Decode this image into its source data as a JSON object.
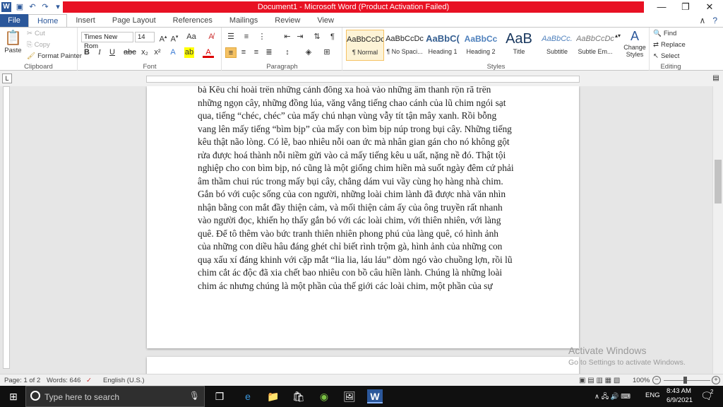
{
  "title_bar": {
    "title": "Document1 - Microsoft Word (Product Activation Failed)",
    "minimize": "—",
    "restore": "❐",
    "close": "✕"
  },
  "tabs": [
    "File",
    "Home",
    "Insert",
    "Page Layout",
    "References",
    "Mailings",
    "Review",
    "View"
  ],
  "ribbon": {
    "clipboard": {
      "label": "Clipboard",
      "paste": "Paste",
      "cut": "Cut",
      "copy": "Copy",
      "format_painter": "Format Painter"
    },
    "font": {
      "label": "Font",
      "font_name": "Times New Rom",
      "font_size": "14"
    },
    "paragraph": {
      "label": "Paragraph"
    },
    "styles": {
      "label": "Styles",
      "items": [
        {
          "preview": "AaBbCcDc",
          "name": "¶ Normal"
        },
        {
          "preview": "AaBbCcDc",
          "name": "¶ No Spaci..."
        },
        {
          "preview": "AaBbC(",
          "name": "Heading 1"
        },
        {
          "preview": "AaBbCc",
          "name": "Heading 2"
        },
        {
          "preview": "AaB",
          "name": "Title"
        },
        {
          "preview": "AaBbCc.",
          "name": "Subtitle"
        },
        {
          "preview": "AaBbCcDc",
          "name": "Subtle Em..."
        }
      ],
      "change_styles": "Change Styles"
    },
    "editing": {
      "label": "Editing",
      "find": "Find",
      "replace": "Replace",
      "select": "Select"
    }
  },
  "document": {
    "lines": [
      "bà Kều chỉ hoài trên những cánh đồng xa hoà vào những âm thanh rộn rã trên",
      "những ngọn cây, những đồng lúa, văng vẳng tiếng chao cánh của lũ chim ngói sạt",
      "qua, tiếng “chéc, chéc” của mấy chú nhạn vùng vẫy tít tận mây xanh. Rồi bỗng",
      "vang lên mấy tiếng “bìm bịp” của mấy con bìm bịp núp trong bụi cây. Những tiếng",
      "kêu thật não lòng. Có lẽ, bao nhiêu nỗi oan ức mà nhân gian gán cho nó không gột",
      "rửa được hoá thành nỗi niềm gửi vào cả mấy tiếng kêu u uất, nặng nề đó. Thật tội",
      "nghiệp cho con bìm bịp, nó cũng là một giống chim hiền mà suốt ngày đêm cứ phải",
      "âm thầm chui rúc trong mấy bụi cây, chẳng dám vui vầy cùng họ hàng nhà chim.",
      "Gắn bó với cuộc sống của con người, những loài chim lành đã được nhà văn nhìn",
      "nhận bằng con mắt đầy thiện cảm, và mối thiện cảm ấy của ông truyền rất nhanh",
      "vào người đọc, khiến họ thấy gắn bó với các loài chim, với thiên nhiên, với làng",
      "quê. Để tô thêm vào bức tranh thiên nhiên phong phú của làng quê, có hình ảnh",
      "của những con diều hâu đáng ghét chỉ biết rình trộm gà, hình ảnh của những con",
      "quạ xấu xí đáng khinh với cặp mắt “lia lia, láu láu” dòm ngó vào chuồng lợn, rồi lũ",
      "chim cắt ác độc đã xia chết bao nhiêu con bồ câu hiền lành. Chúng là những loài",
      "chim ác nhưng chúng là một phần của thế giới các loài chim, một phần của sự"
    ]
  },
  "status_bar": {
    "page": "Page: 1 of 2",
    "words": "Words: 646",
    "language": "English (U.S.)",
    "zoom": "100%"
  },
  "watermark": {
    "line1": "Activate Windows",
    "line2": "Go to Settings to activate Windows."
  },
  "taskbar": {
    "search_placeholder": "Type here to search",
    "language": "ENG",
    "time": "8:43 AM",
    "date": "6/9/2021",
    "notifications": "2"
  }
}
